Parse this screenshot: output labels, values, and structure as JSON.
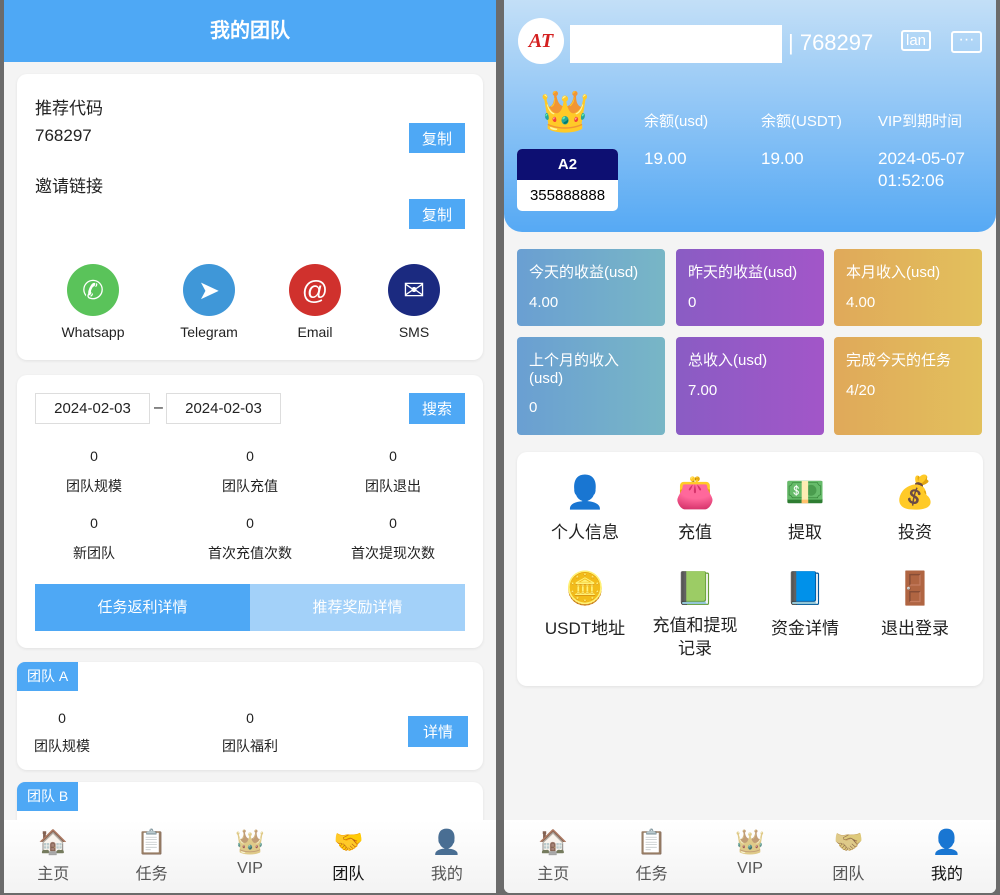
{
  "left": {
    "title": "我的团队",
    "referral": {
      "code_label": "推荐代码",
      "code": "768297",
      "copy": "复制",
      "link_label": "邀请链接",
      "copy2": "复制"
    },
    "share": [
      {
        "label": "Whatsapp",
        "icon": "whatsapp-icon",
        "color": "#5ac35a"
      },
      {
        "label": "Telegram",
        "icon": "telegram-icon",
        "color": "#3f97d8"
      },
      {
        "label": "Email",
        "icon": "email-icon",
        "color": "#d0312d"
      },
      {
        "label": "SMS",
        "icon": "sms-icon",
        "color": "#1b2a80"
      }
    ],
    "filter": {
      "start": "2024-02-03",
      "sep": "–",
      "end": "2024-02-03",
      "search": "搜索"
    },
    "stats": [
      {
        "v": "0",
        "l": "团队规模"
      },
      {
        "v": "0",
        "l": "团队充值"
      },
      {
        "v": "0",
        "l": "团队退出"
      },
      {
        "v": "0",
        "l": "新团队"
      },
      {
        "v": "0",
        "l": "首次充值次数"
      },
      {
        "v": "0",
        "l": "首次提现次数"
      }
    ],
    "tabs": [
      "任务返利详情",
      "推荐奖励详情"
    ],
    "teamA": {
      "tag": "团队 A",
      "size": "0",
      "size_label": "团队规模",
      "welfare": "0",
      "welfare_label": "团队福利",
      "detail": "详情"
    },
    "teamB": {
      "tag": "团队 B"
    }
  },
  "nav": [
    "主页",
    "任务",
    "VIP",
    "团队",
    "我的"
  ],
  "right": {
    "user_id": "768297",
    "lang": "lan",
    "level": "A2",
    "phone": "355888888",
    "balances": [
      {
        "l": "余额(usd)",
        "v": "19.00"
      },
      {
        "l": "余额(USDT)",
        "v": "19.00"
      },
      {
        "l": "VIP到期时间",
        "v": "2024-05-07",
        "v2": "01:52:06"
      }
    ],
    "tiles": [
      {
        "l": "今天的收益(usd)",
        "v": "4.00"
      },
      {
        "l": "昨天的收益(usd)",
        "v": "0"
      },
      {
        "l": "本月收入(usd)",
        "v": "4.00"
      },
      {
        "l": "上个月的收入(usd)",
        "v": "0"
      },
      {
        "l": "总收入(usd)",
        "v": "7.00"
      },
      {
        "l": "完成今天的任务",
        "v": "4/20"
      }
    ],
    "menu": [
      "个人信息",
      "充值",
      "提取",
      "投资",
      "USDT地址",
      "充值和提现记录",
      "资金详情",
      "退出登录"
    ]
  },
  "colors": {
    "accent": "#4ea8f5",
    "tile_teal": "#6aaed0",
    "tile_purple": "#9a5cc8",
    "tile_gold": "#e2b55a"
  }
}
